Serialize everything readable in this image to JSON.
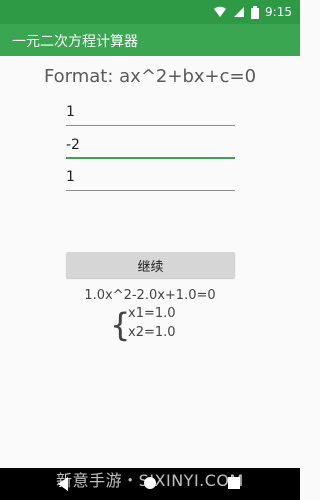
{
  "status_bar": {
    "time": "9:15"
  },
  "app_bar": {
    "title": "一元二次方程计算器"
  },
  "main": {
    "format_text": "Format: ax^2+bx+c=0",
    "inputs": {
      "a": "1",
      "b": "-2",
      "c": "1"
    },
    "continue_label": "继续",
    "equation": "1.0x^2-2.0x+1.0=0",
    "roots": {
      "brace": "{",
      "x1": "x1=1.0",
      "x2": "x2=1.0"
    }
  },
  "watermark": "新意手游・SIXINYI.COM"
}
